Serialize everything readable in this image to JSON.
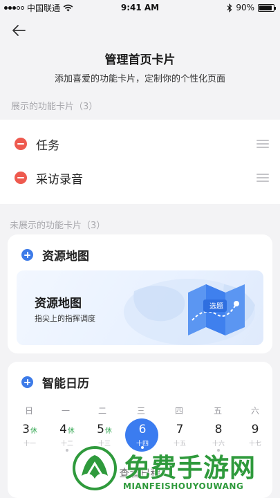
{
  "status_bar": {
    "carrier": "中国联通",
    "time": "9:41 AM",
    "battery_text": "90%",
    "battery_level": 0.9
  },
  "header": {
    "title": "管理首页卡片",
    "subtitle": "添加喜爱的功能卡片，定制你的个性化页面"
  },
  "shown_section": {
    "label": "展示的功能卡片（3）",
    "items": [
      {
        "name": "任务"
      },
      {
        "name": "采访录音"
      }
    ]
  },
  "hidden_section": {
    "label": "未展示的功能卡片（3）",
    "resource_map": {
      "title": "资源地图",
      "banner_title": "资源地图",
      "banner_subtitle": "指尖上的指挥调度",
      "map_tag": "选题"
    },
    "calendar": {
      "title": "智能日历",
      "weekdays": [
        "日",
        "一",
        "二",
        "三",
        "四",
        "五",
        "六"
      ],
      "days": [
        {
          "num": "3",
          "rest": "休",
          "lunar": "十一",
          "dot": false
        },
        {
          "num": "4",
          "rest": "休",
          "lunar": "十二",
          "dot": true
        },
        {
          "num": "5",
          "rest": "休",
          "lunar": "十三",
          "dot": false
        },
        {
          "num": "6",
          "rest": "",
          "lunar": "十四",
          "dot": true,
          "today": true
        },
        {
          "num": "7",
          "rest": "",
          "lunar": "十五",
          "dot": false
        },
        {
          "num": "8",
          "rest": "",
          "lunar": "十六",
          "dot": true
        },
        {
          "num": "9",
          "rest": "",
          "lunar": "十七",
          "dot": false
        }
      ],
      "footer": "查看日程"
    }
  },
  "watermark": {
    "text": "免费手游网",
    "subtext": "MIANFEISHOUYOUWANG"
  },
  "colors": {
    "accent": "#3b7cf0",
    "remove": "#ee5a4f",
    "rest": "#35a853",
    "watermark": "#2f9a3c"
  }
}
